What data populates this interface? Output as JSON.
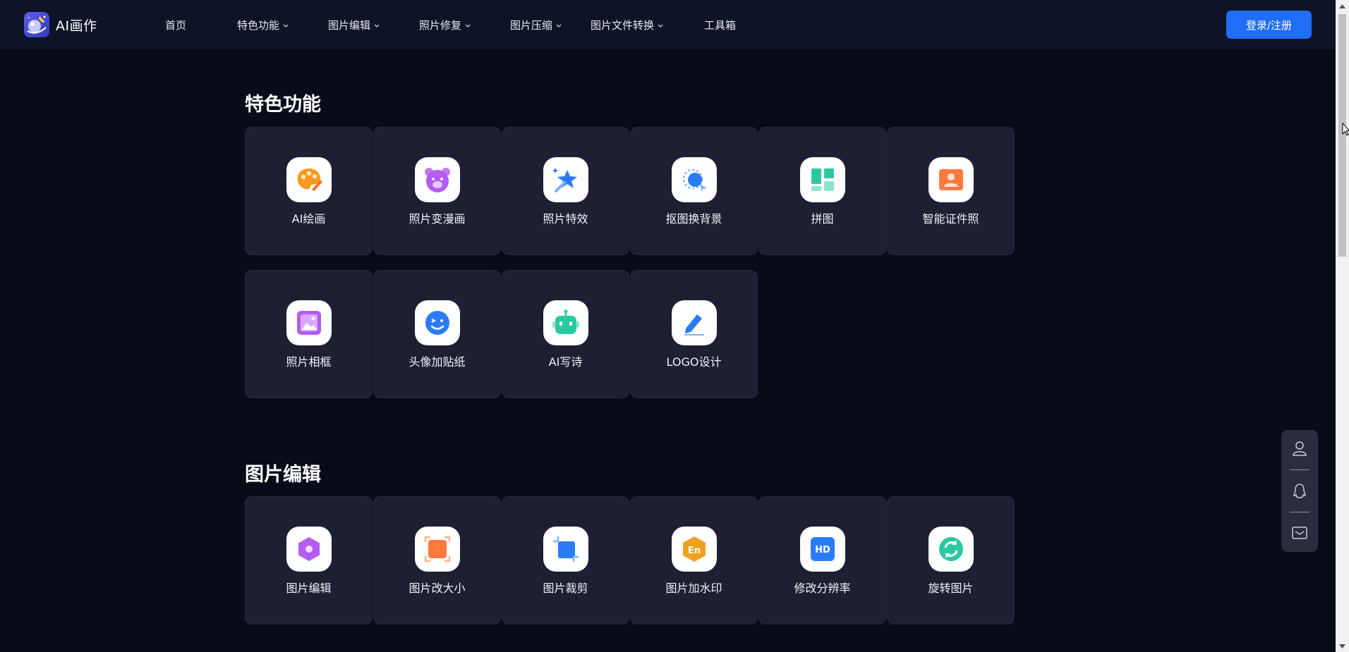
{
  "brand": {
    "name": "AI画作"
  },
  "nav": {
    "items": [
      {
        "label": "首页",
        "has_dropdown": false
      },
      {
        "label": "特色功能",
        "has_dropdown": true
      },
      {
        "label": "图片编辑",
        "has_dropdown": true
      },
      {
        "label": "照片修复",
        "has_dropdown": true
      },
      {
        "label": "图片压缩",
        "has_dropdown": true
      },
      {
        "label": "图片文件转换",
        "has_dropdown": true
      },
      {
        "label": "工具箱",
        "has_dropdown": false
      }
    ],
    "login_label": "登录/注册"
  },
  "sections": [
    {
      "title": "特色功能",
      "cards": [
        {
          "label": "AI绘画",
          "icon": "palette-icon",
          "color": "#ff8a1e"
        },
        {
          "label": "照片变漫画",
          "icon": "bear-face-icon",
          "color": "#b35cf0"
        },
        {
          "label": "照片特效",
          "icon": "magic-wand-icon",
          "color": "#2a7cf6"
        },
        {
          "label": "抠图换背景",
          "icon": "cutout-icon",
          "color": "#2a7cf6"
        },
        {
          "label": "拼图",
          "icon": "puzzle-grid-icon",
          "color": "#2cc9a0"
        },
        {
          "label": "智能证件照",
          "icon": "id-photo-icon",
          "color": "#ff7a3d"
        },
        {
          "label": "照片相框",
          "icon": "photo-frame-icon",
          "color": "#b35cf0"
        },
        {
          "label": "头像加贴纸",
          "icon": "sticker-face-icon",
          "color": "#2a7cf6"
        },
        {
          "label": "AI写诗",
          "icon": "robot-icon",
          "color": "#2cc9a0"
        },
        {
          "label": "LOGO设计",
          "icon": "pen-design-icon",
          "color": "#2a7cf6"
        }
      ]
    },
    {
      "title": "图片编辑",
      "cards": [
        {
          "label": "图片编辑",
          "icon": "hexagon-edit-icon",
          "color": "#b35cf0"
        },
        {
          "label": "图片改大小",
          "icon": "resize-icon",
          "color": "#ff7a3d"
        },
        {
          "label": "图片裁剪",
          "icon": "crop-icon",
          "color": "#2a7cf6"
        },
        {
          "label": "图片加水印",
          "icon": "watermark-icon",
          "color": "#f0a020"
        },
        {
          "label": "修改分辨率",
          "icon": "hd-icon",
          "color": "#2a7cf6"
        },
        {
          "label": "旋转图片",
          "icon": "rotate-icon",
          "color": "#2cc9a0"
        }
      ]
    }
  ],
  "float_toolbar": {
    "buttons": [
      {
        "icon": "user-icon"
      },
      {
        "icon": "qq-penguin-icon"
      },
      {
        "icon": "mail-icon"
      }
    ]
  },
  "colors": {
    "background": "#080b18",
    "header": "#0f1327",
    "card": "#1d2033",
    "accent": "#1f6ef5"
  }
}
